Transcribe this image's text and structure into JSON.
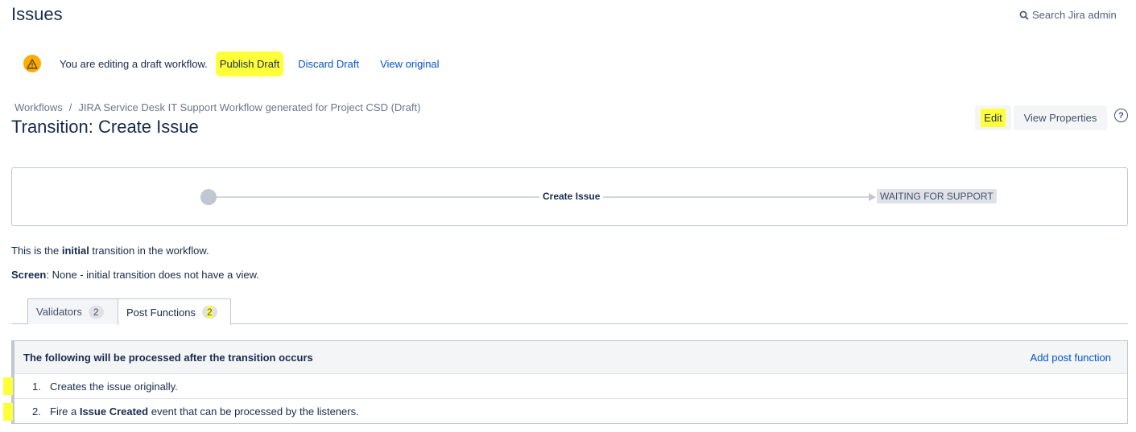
{
  "header": {
    "title": "Issues",
    "search_label": "Search Jira admin"
  },
  "draft_bar": {
    "message": "You are editing a draft workflow.",
    "publish_label": "Publish Draft",
    "discard_label": "Discard Draft",
    "view_original_label": "View original"
  },
  "breadcrumb": {
    "root": "Workflows",
    "separator": "/",
    "current": "JIRA Service Desk IT Support Workflow generated for Project CSD (Draft)"
  },
  "transition": {
    "title": "Transition: Create Issue",
    "edit_label": "Edit",
    "view_properties_label": "View Properties",
    "help_symbol": "?"
  },
  "diagram": {
    "transition_name": "Create Issue",
    "target_status": "WAITING FOR SUPPORT"
  },
  "info": {
    "initial_prefix": "This is the ",
    "initial_bold": "initial",
    "initial_suffix": " transition in the workflow.",
    "screen_label": "Screen",
    "screen_value": ": None - initial transition does not have a view."
  },
  "tabs": [
    {
      "label": "Validators",
      "count": "2"
    },
    {
      "label": "Post Functions",
      "count": "2"
    }
  ],
  "post_functions": {
    "header": "The following will be processed after the transition occurs",
    "add_label": "Add post function",
    "items": [
      {
        "num": "1.",
        "prefix": "Creates the issue originally.",
        "bold": "",
        "suffix": ""
      },
      {
        "num": "2.",
        "prefix": "Fire a ",
        "bold": "Issue Created",
        "suffix": " event that can be processed by the listeners."
      }
    ]
  },
  "colors": {
    "highlight": "#ffff3a",
    "link": "#0052cc",
    "text": "#172b4d",
    "warning": "#ffab00"
  }
}
